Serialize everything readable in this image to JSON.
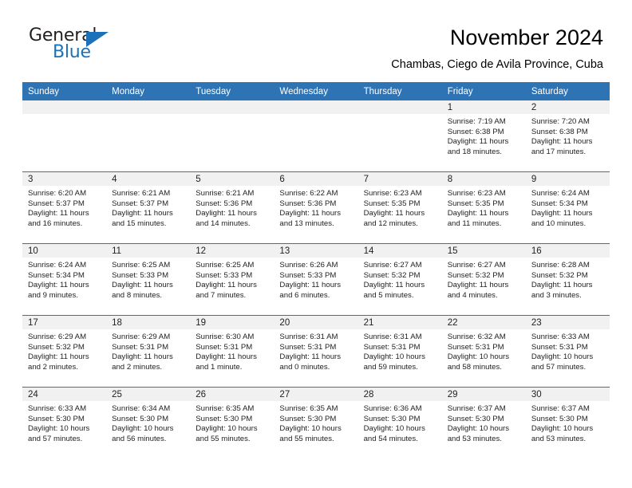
{
  "brand": {
    "name_part1": "General",
    "name_part2": "Blue",
    "logo_icon": "triangle-flag-icon",
    "accent_color": "#1b72b8"
  },
  "header": {
    "month_title": "November 2024",
    "location": "Chambas, Ciego de Avila Province, Cuba"
  },
  "theme": {
    "header_blue": "#2e74b5",
    "daynum_band": "#f1f1f1",
    "text": "#222222"
  },
  "weekday_headers": [
    "Sunday",
    "Monday",
    "Tuesday",
    "Wednesday",
    "Thursday",
    "Friday",
    "Saturday"
  ],
  "weeks": [
    {
      "days": [
        {
          "date": "",
          "empty": true,
          "sunrise": "",
          "sunset": "",
          "daylight_line1": "",
          "daylight_line2": ""
        },
        {
          "date": "",
          "empty": true,
          "sunrise": "",
          "sunset": "",
          "daylight_line1": "",
          "daylight_line2": ""
        },
        {
          "date": "",
          "empty": true,
          "sunrise": "",
          "sunset": "",
          "daylight_line1": "",
          "daylight_line2": ""
        },
        {
          "date": "",
          "empty": true,
          "sunrise": "",
          "sunset": "",
          "daylight_line1": "",
          "daylight_line2": ""
        },
        {
          "date": "",
          "empty": true,
          "sunrise": "",
          "sunset": "",
          "daylight_line1": "",
          "daylight_line2": ""
        },
        {
          "date": "1",
          "empty": false,
          "sunrise": "Sunrise: 7:19 AM",
          "sunset": "Sunset: 6:38 PM",
          "daylight_line1": "Daylight: 11 hours",
          "daylight_line2": "and 18 minutes."
        },
        {
          "date": "2",
          "empty": false,
          "sunrise": "Sunrise: 7:20 AM",
          "sunset": "Sunset: 6:38 PM",
          "daylight_line1": "Daylight: 11 hours",
          "daylight_line2": "and 17 minutes."
        }
      ]
    },
    {
      "days": [
        {
          "date": "3",
          "empty": false,
          "sunrise": "Sunrise: 6:20 AM",
          "sunset": "Sunset: 5:37 PM",
          "daylight_line1": "Daylight: 11 hours",
          "daylight_line2": "and 16 minutes."
        },
        {
          "date": "4",
          "empty": false,
          "sunrise": "Sunrise: 6:21 AM",
          "sunset": "Sunset: 5:37 PM",
          "daylight_line1": "Daylight: 11 hours",
          "daylight_line2": "and 15 minutes."
        },
        {
          "date": "5",
          "empty": false,
          "sunrise": "Sunrise: 6:21 AM",
          "sunset": "Sunset: 5:36 PM",
          "daylight_line1": "Daylight: 11 hours",
          "daylight_line2": "and 14 minutes."
        },
        {
          "date": "6",
          "empty": false,
          "sunrise": "Sunrise: 6:22 AM",
          "sunset": "Sunset: 5:36 PM",
          "daylight_line1": "Daylight: 11 hours",
          "daylight_line2": "and 13 minutes."
        },
        {
          "date": "7",
          "empty": false,
          "sunrise": "Sunrise: 6:23 AM",
          "sunset": "Sunset: 5:35 PM",
          "daylight_line1": "Daylight: 11 hours",
          "daylight_line2": "and 12 minutes."
        },
        {
          "date": "8",
          "empty": false,
          "sunrise": "Sunrise: 6:23 AM",
          "sunset": "Sunset: 5:35 PM",
          "daylight_line1": "Daylight: 11 hours",
          "daylight_line2": "and 11 minutes."
        },
        {
          "date": "9",
          "empty": false,
          "sunrise": "Sunrise: 6:24 AM",
          "sunset": "Sunset: 5:34 PM",
          "daylight_line1": "Daylight: 11 hours",
          "daylight_line2": "and 10 minutes."
        }
      ]
    },
    {
      "days": [
        {
          "date": "10",
          "empty": false,
          "sunrise": "Sunrise: 6:24 AM",
          "sunset": "Sunset: 5:34 PM",
          "daylight_line1": "Daylight: 11 hours",
          "daylight_line2": "and 9 minutes."
        },
        {
          "date": "11",
          "empty": false,
          "sunrise": "Sunrise: 6:25 AM",
          "sunset": "Sunset: 5:33 PM",
          "daylight_line1": "Daylight: 11 hours",
          "daylight_line2": "and 8 minutes."
        },
        {
          "date": "12",
          "empty": false,
          "sunrise": "Sunrise: 6:25 AM",
          "sunset": "Sunset: 5:33 PM",
          "daylight_line1": "Daylight: 11 hours",
          "daylight_line2": "and 7 minutes."
        },
        {
          "date": "13",
          "empty": false,
          "sunrise": "Sunrise: 6:26 AM",
          "sunset": "Sunset: 5:33 PM",
          "daylight_line1": "Daylight: 11 hours",
          "daylight_line2": "and 6 minutes."
        },
        {
          "date": "14",
          "empty": false,
          "sunrise": "Sunrise: 6:27 AM",
          "sunset": "Sunset: 5:32 PM",
          "daylight_line1": "Daylight: 11 hours",
          "daylight_line2": "and 5 minutes."
        },
        {
          "date": "15",
          "empty": false,
          "sunrise": "Sunrise: 6:27 AM",
          "sunset": "Sunset: 5:32 PM",
          "daylight_line1": "Daylight: 11 hours",
          "daylight_line2": "and 4 minutes."
        },
        {
          "date": "16",
          "empty": false,
          "sunrise": "Sunrise: 6:28 AM",
          "sunset": "Sunset: 5:32 PM",
          "daylight_line1": "Daylight: 11 hours",
          "daylight_line2": "and 3 minutes."
        }
      ]
    },
    {
      "days": [
        {
          "date": "17",
          "empty": false,
          "sunrise": "Sunrise: 6:29 AM",
          "sunset": "Sunset: 5:32 PM",
          "daylight_line1": "Daylight: 11 hours",
          "daylight_line2": "and 2 minutes."
        },
        {
          "date": "18",
          "empty": false,
          "sunrise": "Sunrise: 6:29 AM",
          "sunset": "Sunset: 5:31 PM",
          "daylight_line1": "Daylight: 11 hours",
          "daylight_line2": "and 2 minutes."
        },
        {
          "date": "19",
          "empty": false,
          "sunrise": "Sunrise: 6:30 AM",
          "sunset": "Sunset: 5:31 PM",
          "daylight_line1": "Daylight: 11 hours",
          "daylight_line2": "and 1 minute."
        },
        {
          "date": "20",
          "empty": false,
          "sunrise": "Sunrise: 6:31 AM",
          "sunset": "Sunset: 5:31 PM",
          "daylight_line1": "Daylight: 11 hours",
          "daylight_line2": "and 0 minutes."
        },
        {
          "date": "21",
          "empty": false,
          "sunrise": "Sunrise: 6:31 AM",
          "sunset": "Sunset: 5:31 PM",
          "daylight_line1": "Daylight: 10 hours",
          "daylight_line2": "and 59 minutes."
        },
        {
          "date": "22",
          "empty": false,
          "sunrise": "Sunrise: 6:32 AM",
          "sunset": "Sunset: 5:31 PM",
          "daylight_line1": "Daylight: 10 hours",
          "daylight_line2": "and 58 minutes."
        },
        {
          "date": "23",
          "empty": false,
          "sunrise": "Sunrise: 6:33 AM",
          "sunset": "Sunset: 5:31 PM",
          "daylight_line1": "Daylight: 10 hours",
          "daylight_line2": "and 57 minutes."
        }
      ]
    },
    {
      "days": [
        {
          "date": "24",
          "empty": false,
          "sunrise": "Sunrise: 6:33 AM",
          "sunset": "Sunset: 5:30 PM",
          "daylight_line1": "Daylight: 10 hours",
          "daylight_line2": "and 57 minutes."
        },
        {
          "date": "25",
          "empty": false,
          "sunrise": "Sunrise: 6:34 AM",
          "sunset": "Sunset: 5:30 PM",
          "daylight_line1": "Daylight: 10 hours",
          "daylight_line2": "and 56 minutes."
        },
        {
          "date": "26",
          "empty": false,
          "sunrise": "Sunrise: 6:35 AM",
          "sunset": "Sunset: 5:30 PM",
          "daylight_line1": "Daylight: 10 hours",
          "daylight_line2": "and 55 minutes."
        },
        {
          "date": "27",
          "empty": false,
          "sunrise": "Sunrise: 6:35 AM",
          "sunset": "Sunset: 5:30 PM",
          "daylight_line1": "Daylight: 10 hours",
          "daylight_line2": "and 55 minutes."
        },
        {
          "date": "28",
          "empty": false,
          "sunrise": "Sunrise: 6:36 AM",
          "sunset": "Sunset: 5:30 PM",
          "daylight_line1": "Daylight: 10 hours",
          "daylight_line2": "and 54 minutes."
        },
        {
          "date": "29",
          "empty": false,
          "sunrise": "Sunrise: 6:37 AM",
          "sunset": "Sunset: 5:30 PM",
          "daylight_line1": "Daylight: 10 hours",
          "daylight_line2": "and 53 minutes."
        },
        {
          "date": "30",
          "empty": false,
          "sunrise": "Sunrise: 6:37 AM",
          "sunset": "Sunset: 5:30 PM",
          "daylight_line1": "Daylight: 10 hours",
          "daylight_line2": "and 53 minutes."
        }
      ]
    }
  ]
}
